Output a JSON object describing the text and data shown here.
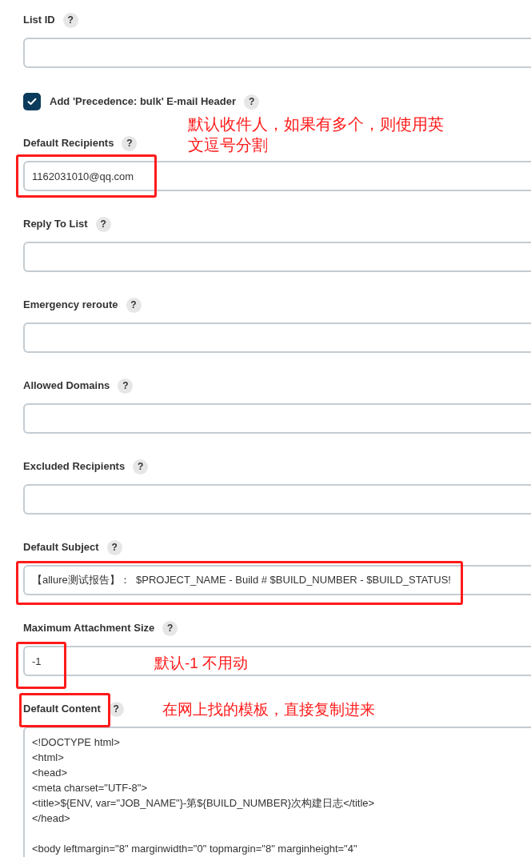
{
  "fields": [
    {
      "kind": "text",
      "label": "List ID"
    },
    {
      "kind": "checkbox",
      "label": "Add 'Precedence: bulk' E-mail Header",
      "checked": true
    },
    {
      "kind": "text",
      "label": "Default Recipients",
      "value": "1162031010@qq.com"
    },
    {
      "kind": "text",
      "label": "Reply To List"
    },
    {
      "kind": "text",
      "label": "Emergency reroute"
    },
    {
      "kind": "text",
      "label": "Allowed Domains"
    },
    {
      "kind": "text",
      "label": "Excluded Recipients"
    },
    {
      "kind": "text",
      "label": "Default Subject",
      "value": "【allure测试报告】：  $PROJECT_NAME - Build # $BUILD_NUMBER - $BUILD_STATUS!"
    },
    {
      "kind": "text",
      "label": "Maximum Attachment Size",
      "value": "-1"
    },
    {
      "kind": "textarea",
      "label": "Default Content",
      "paragraphs": [
        [
          "<!DOCTYPE html>",
          "<html>",
          "<head>",
          "<meta charset=\"UTF-8\">",
          "<title>${ENV, var=\"JOB_NAME\"}-第${BUILD_NUMBER}次构建日志</title>",
          "</head>"
        ],
        [
          "<body leftmargin=\"8\" marginwidth=\"0\" topmargin=\"8\" marginheight=\"4\""
        ]
      ]
    }
  ],
  "help_mark": "?",
  "annotations": [
    {
      "kind": "text",
      "text": "默认收件人，如果有多个，则使用英文逗号分割"
    },
    {
      "kind": "box"
    },
    {
      "kind": "box"
    },
    {
      "kind": "text",
      "text": "默认-1  不用动"
    },
    {
      "kind": "box"
    },
    {
      "kind": "box"
    },
    {
      "kind": "text",
      "text": "在网上找的模板，直接复制进来"
    }
  ]
}
